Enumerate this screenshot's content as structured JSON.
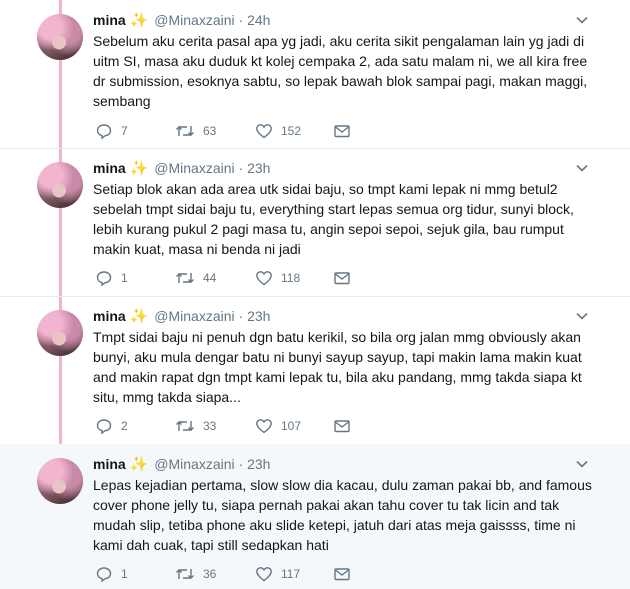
{
  "user": {
    "name": "mina",
    "badge": "✨",
    "handle": "@Minaxzaini"
  },
  "colors": {
    "thread_line": "#f4b6c7",
    "muted": "#657786",
    "text": "#14171a",
    "highlight_bg": "#f5f8fa"
  },
  "tweets": [
    {
      "time": "24h",
      "text": "Sebelum aku cerita pasal apa yg jadi, aku cerita sikit pengalaman lain yg jadi di uitm SI, masa aku duduk kt kolej cempaka 2, ada satu malam ni, we all kira free dr submission, esoknya sabtu, so lepak bawah blok sampai pagi, makan maggi, sembang",
      "replies": "7",
      "retweets": "63",
      "likes": "152"
    },
    {
      "time": "23h",
      "text": "Setiap blok akan ada area utk sidai baju, so tmpt kami lepak ni mmg betul2 sebelah tmpt sidai baju tu, everything start lepas semua org tidur, sunyi block, lebih kurang pukul 2 pagi masa tu, angin sepoi sepoi, sejuk gila, bau rumput makin kuat, masa ni benda ni jadi",
      "replies": "1",
      "retweets": "44",
      "likes": "118"
    },
    {
      "time": "23h",
      "text": "Tmpt sidai baju ni penuh dgn batu kerikil, so bila org jalan mmg obviously akan bunyi, aku mula dengar batu ni bunyi sayup sayup, tapi makin lama makin kuat and makin rapat dgn tmpt kami lepak tu, bila aku pandang, mmg takda siapa kt situ, mmg takda siapa...",
      "replies": "2",
      "retweets": "33",
      "likes": "107"
    },
    {
      "time": "23h",
      "text": "Lepas kejadian pertama, slow slow dia kacau, dulu zaman pakai bb, and famous cover phone jelly tu, siapa pernah pakai akan tahu cover tu tak licin and tak mudah slip, tetiba phone aku slide ketepi, jatuh dari atas meja gaissss, time ni kami dah cuak, tapi still sedapkan hati",
      "replies": "1",
      "retweets": "36",
      "likes": "117"
    }
  ]
}
